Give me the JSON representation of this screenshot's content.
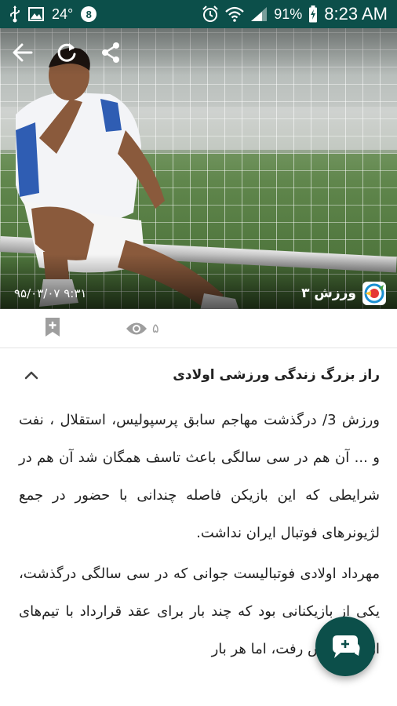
{
  "status_bar": {
    "temperature": "24°",
    "notification_badge": "8",
    "battery": "91%",
    "time": "8:23 AM"
  },
  "hero": {
    "date": "۹۵/۰۳/۰۷ ۹:۳۱",
    "source_name": "ورزش ۳"
  },
  "actions": {
    "view_count": "۵"
  },
  "article": {
    "title": "راز بزرگ زندگی ورزشی اولادی",
    "paragraphs": [
      "ورزش 3/ درگذشت مهاجم سابق پرسپولیس، استقلال ، نفت و ... آن هم در سی سالگی باعث تاسف همگان شد آن هم در شرایطی که این بازیکن فاصله چندانی با حضور در جمع لژیونرهای فوتبال ایران نداشت.",
      "مهرداد اولادی فوتبالیست جوانی که در سی سالگی درگذشت، یکی از بازیکنانی بود که چند بار برای عقد قرارداد با تیم‌های اروپایی پیش رفت، اما هر بار"
    ]
  },
  "colors": {
    "primary": "#0c4f4a",
    "muted": "#9e9e9e"
  },
  "icons": [
    "usb-icon",
    "image-icon",
    "alarm-icon",
    "wifi-icon",
    "signal-icon",
    "battery-icon",
    "back-arrow-icon",
    "refresh-icon",
    "share-icon",
    "source-logo-icon",
    "bookmark-add-icon",
    "eye-icon",
    "chevron-up-icon",
    "add-comment-icon"
  ]
}
